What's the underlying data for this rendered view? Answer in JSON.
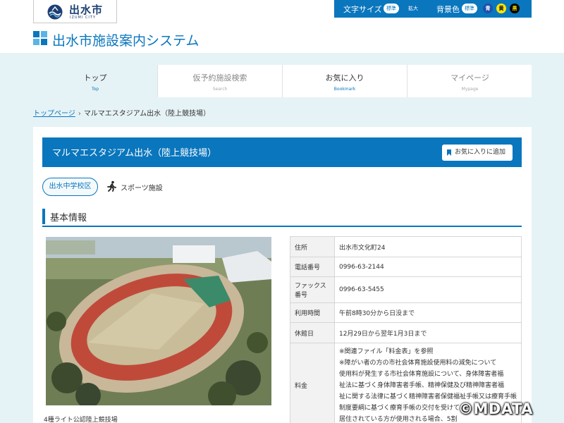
{
  "header": {
    "logo_text": "出水市",
    "logo_sub": "IZUMI CITY",
    "site_title": "出水市施設案内システム"
  },
  "toolbar": {
    "font_size_label": "文字サイズ",
    "font_standard": "標準",
    "font_large": "拡大",
    "bg_color_label": "背景色",
    "bg_standard": "標準",
    "bg_blue": "青",
    "bg_yellow": "黄",
    "bg_black": "黒"
  },
  "nav": [
    {
      "label": "トップ",
      "sub": "Top"
    },
    {
      "label": "仮予約施設検索",
      "sub": "Search"
    },
    {
      "label": "お気に入り",
      "sub": "Bookmark"
    },
    {
      "label": "マイページ",
      "sub": "Mypage"
    }
  ],
  "breadcrumb": {
    "home": "トップページ",
    "separator": "›",
    "current": "マルマエスタジアム出水（陸上競技場）"
  },
  "facility": {
    "title": "マルマエスタジアム出水（陸上競技場）",
    "favorite_button": "お気に入りに追加",
    "area_tag": "出水中学校区",
    "category": "スポーツ施設",
    "photo_caption": "4種ライト公認陸上競技場"
  },
  "section": {
    "title": "基本情報"
  },
  "info": {
    "address_label": "住所",
    "address": "出水市文化町24",
    "phone_label": "電話番号",
    "phone": "0996-63-2144",
    "fax_label": "ファックス番号",
    "fax": "0996-63-5455",
    "hours_label": "利用時間",
    "hours": "午前8時30分から日没まで",
    "closed_label": "休館日",
    "closed": "12月29日から翌年1月3日まで",
    "fee_label": "料金",
    "fee_lines": [
      "※関連ファイル「料金表」を参照",
      "※障がい者の方の市社会体育施設使用料の減免について",
      "使用料が発生する市社会体育施設について、身体障害者福",
      "祉法に基づく身体障害者手帳、精神保健及び精神障害者福",
      "祉に関する法律に基づく精神障害者保健福祉手帳又は療育手帳",
      "制度要綱に基づく療育手帳の交付を受けて",
      "居住されている方が使用される場合、5割"
    ]
  },
  "watermark": "©MDATA",
  "colors": {
    "primary": "#0a76bd",
    "band": "#e6f3f6",
    "bg_blue_swatch": "#1f4fa8",
    "bg_yellow_swatch": "#ffe600",
    "bg_black_swatch": "#000000"
  }
}
